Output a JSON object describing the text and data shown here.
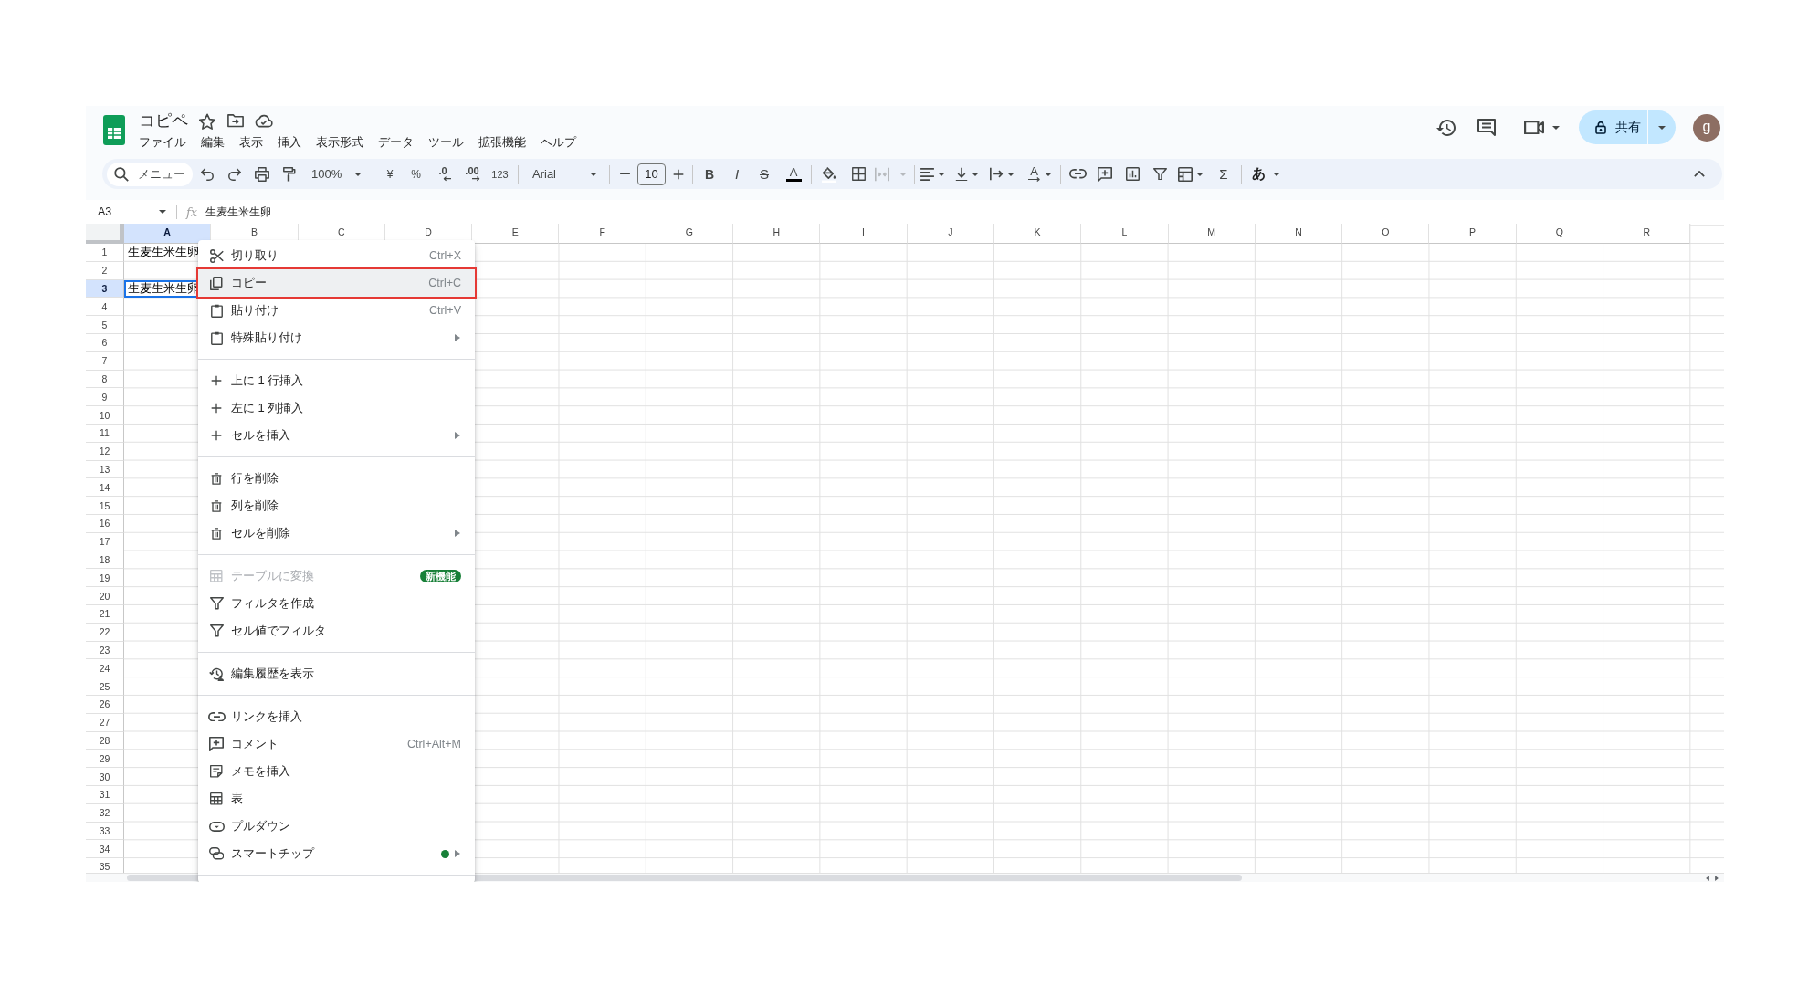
{
  "document": {
    "title": "コピペ"
  },
  "menu_bar": [
    "ファイル",
    "編集",
    "表示",
    "挿入",
    "表示形式",
    "データ",
    "ツール",
    "拡張機能",
    "ヘルプ"
  ],
  "share_button": {
    "label": "共有"
  },
  "account": {
    "initial": "g"
  },
  "toolbar": {
    "search": {
      "placeholder": "メニュー"
    },
    "zoom": "100%",
    "currency": "¥",
    "percent": "%",
    "decimal_decrease": ".0",
    "decimal_increase": ".00",
    "number_format": "123",
    "font": "Arial",
    "font_size": "10",
    "bold": "B",
    "italic": "I",
    "strikethrough": "S",
    "text_color": "A",
    "merge": {
      "disabled": true
    },
    "text_rotation": "A",
    "functions": "Σ",
    "input_tools": "あ"
  },
  "formula_bar": {
    "cell": "A3",
    "function_label": "fx",
    "content": "生麦生米生卵"
  },
  "grid": {
    "columns": [
      {
        "label": "A",
        "selected": true
      },
      {
        "label": "B",
        "selected": false
      },
      {
        "label": "C",
        "selected": false
      },
      {
        "label": "D",
        "selected": false
      },
      {
        "label": "E",
        "selected": false
      },
      {
        "label": "F",
        "selected": false
      },
      {
        "label": "G",
        "selected": false
      },
      {
        "label": "H",
        "selected": false
      },
      {
        "label": "I",
        "selected": false
      },
      {
        "label": "J",
        "selected": false
      },
      {
        "label": "K",
        "selected": false
      },
      {
        "label": "L",
        "selected": false
      },
      {
        "label": "M",
        "selected": false
      },
      {
        "label": "N",
        "selected": false
      },
      {
        "label": "O",
        "selected": false
      },
      {
        "label": "P",
        "selected": false
      },
      {
        "label": "Q",
        "selected": false
      },
      {
        "label": "R",
        "selected": false
      }
    ],
    "rows": [
      {
        "label": "1",
        "selected": false,
        "cells": [
          {
            "value": "生麦生米生卵",
            "selected": false
          }
        ]
      },
      {
        "label": "2",
        "selected": false
      },
      {
        "label": "3",
        "selected": true,
        "cells": [
          {
            "value": "生麦生米生卵",
            "selected": true
          }
        ]
      },
      {
        "label": "4",
        "selected": false
      },
      {
        "label": "5",
        "selected": false
      },
      {
        "label": "6",
        "selected": false
      },
      {
        "label": "7",
        "selected": false
      },
      {
        "label": "8",
        "selected": false
      },
      {
        "label": "9",
        "selected": false
      },
      {
        "label": "10",
        "selected": false
      },
      {
        "label": "11",
        "selected": false
      },
      {
        "label": "12",
        "selected": false
      },
      {
        "label": "13",
        "selected": false
      },
      {
        "label": "14",
        "selected": false
      },
      {
        "label": "15",
        "selected": false
      },
      {
        "label": "16",
        "selected": false
      },
      {
        "label": "17",
        "selected": false
      },
      {
        "label": "18",
        "selected": false
      },
      {
        "label": "19",
        "selected": false
      },
      {
        "label": "20",
        "selected": false
      },
      {
        "label": "21",
        "selected": false
      },
      {
        "label": "22",
        "selected": false
      },
      {
        "label": "23",
        "selected": false
      },
      {
        "label": "24",
        "selected": false
      },
      {
        "label": "25",
        "selected": false
      },
      {
        "label": "26",
        "selected": false
      },
      {
        "label": "27",
        "selected": false
      },
      {
        "label": "28",
        "selected": false
      },
      {
        "label": "29",
        "selected": false
      },
      {
        "label": "30",
        "selected": false
      },
      {
        "label": "31",
        "selected": false
      },
      {
        "label": "32",
        "selected": false
      },
      {
        "label": "33",
        "selected": false
      },
      {
        "label": "34",
        "selected": false
      },
      {
        "label": "35",
        "selected": false
      }
    ]
  },
  "context_menu": {
    "groups": [
      {
        "items": [
          {
            "kind": "cut",
            "label": "切り取り",
            "shortcut": "Ctrl+X",
            "submenu": false,
            "disabled": false,
            "highlighted": false,
            "dot": false
          },
          {
            "kind": "copy",
            "label": "コピー",
            "shortcut": "Ctrl+C",
            "submenu": false,
            "disabled": false,
            "highlighted": true,
            "dot": false
          },
          {
            "kind": "paste",
            "label": "貼り付け",
            "shortcut": "Ctrl+V",
            "submenu": false,
            "disabled": false,
            "highlighted": false,
            "dot": false
          },
          {
            "kind": "paste",
            "label": "特殊貼り付け",
            "submenu": true,
            "disabled": false,
            "highlighted": false,
            "dot": false
          }
        ]
      },
      {
        "items": [
          {
            "kind": "insert",
            "label": "上に 1 行挿入",
            "submenu": false,
            "disabled": false,
            "highlighted": false,
            "dot": false
          },
          {
            "kind": "insert",
            "label": "左に 1 列挿入",
            "submenu": false,
            "disabled": false,
            "highlighted": false,
            "dot": false
          },
          {
            "kind": "insert",
            "label": "セルを挿入",
            "submenu": true,
            "disabled": false,
            "highlighted": false,
            "dot": false
          }
        ]
      },
      {
        "items": [
          {
            "kind": "delete",
            "label": "行を削除",
            "submenu": false,
            "disabled": false,
            "highlighted": false,
            "dot": false
          },
          {
            "kind": "delete",
            "label": "列を削除",
            "submenu": false,
            "disabled": false,
            "highlighted": false,
            "dot": false
          },
          {
            "kind": "delete",
            "label": "セルを削除",
            "submenu": true,
            "disabled": false,
            "highlighted": false,
            "dot": false
          }
        ]
      },
      {
        "items": [
          {
            "kind": "convert",
            "label": "テーブルに変換",
            "badge": "新機能",
            "submenu": false,
            "disabled": true,
            "highlighted": false,
            "dot": false
          },
          {
            "kind": "filter",
            "label": "フィルタを作成",
            "submenu": false,
            "disabled": false,
            "highlighted": false,
            "dot": false
          },
          {
            "kind": "filter",
            "label": "セル値でフィルタ",
            "submenu": false,
            "disabled": false,
            "highlighted": false,
            "dot": false
          }
        ]
      },
      {
        "items": [
          {
            "kind": "history",
            "label": "編集履歴を表示",
            "submenu": false,
            "disabled": false,
            "highlighted": false,
            "dot": false
          }
        ]
      },
      {
        "items": [
          {
            "kind": "link",
            "label": "リンクを挿入",
            "submenu": false,
            "disabled": false,
            "highlighted": false,
            "dot": false
          },
          {
            "kind": "comment",
            "label": "コメント",
            "shortcut": "Ctrl+Alt+M",
            "submenu": false,
            "disabled": false,
            "highlighted": false,
            "dot": false
          },
          {
            "kind": "note",
            "label": "メモを挿入",
            "submenu": false,
            "disabled": false,
            "highlighted": false,
            "dot": false
          },
          {
            "kind": "table",
            "label": "表",
            "submenu": false,
            "disabled": false,
            "highlighted": false,
            "dot": false
          },
          {
            "kind": "dropdown",
            "label": "プルダウン",
            "submenu": false,
            "disabled": false,
            "highlighted": false,
            "dot": false
          },
          {
            "kind": "chips",
            "label": "スマートチップ",
            "submenu": true,
            "disabled": false,
            "highlighted": false,
            "dot": true
          }
        ]
      }
    ]
  }
}
